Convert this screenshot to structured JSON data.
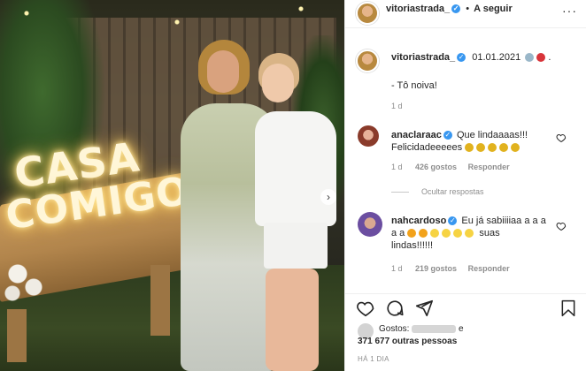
{
  "header": {
    "username": "vitoriastrada_",
    "follow_sep": "•",
    "follow_label": "A seguir",
    "more_icon": "more-horizontal-icon"
  },
  "caption": {
    "username": "vitoriastrada_",
    "date_text": "01.01.2021",
    "text": "- Tô noiva!",
    "age": "1 d"
  },
  "comments": [
    {
      "username": "anaclaraac",
      "line1": "Que lindaaaas!!!",
      "line2": "Felicidadeeeees",
      "age": "1 d",
      "likes": "426 gostos",
      "reply_label": "Responder",
      "hide_replies_label": "Ocultar respostas"
    },
    {
      "username": "nahcardoso",
      "line1": "Eu já sabiiiiaa a a a",
      "line2_prefix": "a a",
      "line2_suffix": "suas",
      "line3": "lindas!!!!!!",
      "age": "1 d",
      "likes": "219 gostos",
      "reply_label": "Responder"
    }
  ],
  "likes_section": {
    "prefix": "Gostos:",
    "conj": "e",
    "others": "371 677 outras pessoas",
    "time": "HÁ 1 DIA"
  },
  "photo": {
    "sign_line1": "CASA",
    "sign_line2": "COMIGO",
    "next_icon": "chevron-right-icon"
  },
  "icons": [
    "heart-icon",
    "comment-icon",
    "share-icon",
    "bookmark-icon",
    "verified-badge-icon"
  ],
  "colors": {
    "verified": "#3897f0",
    "meta_gray": "#8e8e8e",
    "text": "#262626",
    "border": "#efefef"
  }
}
